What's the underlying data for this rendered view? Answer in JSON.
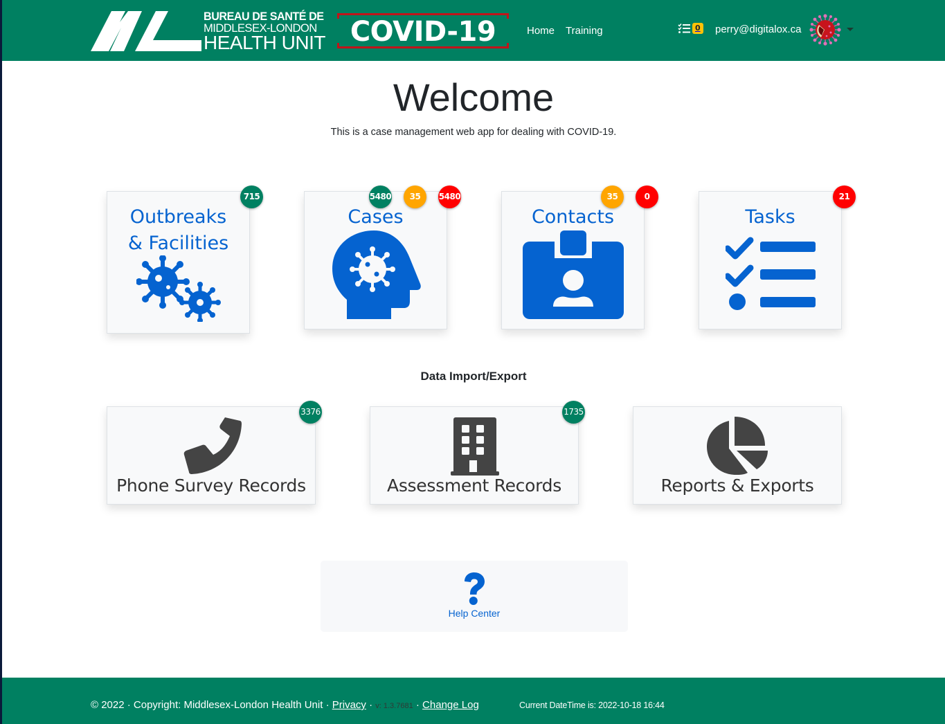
{
  "navbar": {
    "logo_mark": "ML",
    "logo_line1": "BUREAU DE SANTÉ DE",
    "logo_line2": "MIDDLESEX-LONDON",
    "logo_line3": "HEALTH UNIT",
    "app_badge": "COVID-19",
    "links": [
      {
        "label": "Home"
      },
      {
        "label": "Training"
      }
    ],
    "task_count": "0",
    "user_email": "perry@digitalox.ca",
    "avatar_icon": "coronavirus-avatar",
    "colors": {
      "brand": "#008061",
      "covid_border": "#c0141a",
      "task_badge": "#ffc107"
    }
  },
  "hero": {
    "title": "Welcome",
    "subtitle": "This is a case management web app for dealing with COVID-19."
  },
  "tiles": [
    {
      "title_line1": "Outbreaks",
      "title_line2": "& Facilities",
      "icon": "viruses-icon",
      "badges": [
        {
          "value": "715",
          "color": "green"
        }
      ]
    },
    {
      "title": "Cases",
      "icon": "head-virus-icon",
      "badges": [
        {
          "value": "5480",
          "color": "green"
        },
        {
          "value": "35",
          "color": "orange"
        },
        {
          "value": "5480",
          "color": "red"
        }
      ]
    },
    {
      "title": "Contacts",
      "icon": "id-badge-icon",
      "badges": [
        {
          "value": "35",
          "color": "orange"
        },
        {
          "value": "0",
          "color": "red"
        }
      ]
    },
    {
      "title": "Tasks",
      "icon": "tasks-list-icon",
      "badges": [
        {
          "value": "21",
          "color": "red"
        }
      ]
    }
  ],
  "data_section": {
    "label": "Data Import/Export",
    "tiles": [
      {
        "title": "Phone Survey Records",
        "icon": "phone-icon",
        "badge": "3376"
      },
      {
        "title": "Assessment Records",
        "icon": "building-icon",
        "badge": "1735"
      },
      {
        "title": "Reports & Exports",
        "icon": "pie-chart-icon"
      }
    ]
  },
  "help": {
    "label": "Help Center",
    "icon": "question-icon"
  },
  "footer": {
    "copyright": "© 2022 · Copyright: Middlesex-London Health Unit · ",
    "privacy": "Privacy",
    "sep1": " · ",
    "version": "v: 1.3.7681",
    "sep2": " · ",
    "changelog": "Change Log",
    "datetime": "Current DateTime is: 2022-10-18 16:44"
  },
  "colors": {
    "tile_title": "#0563d0",
    "badge_green": "#008061",
    "badge_orange": "#ffa500",
    "badge_red": "#ff0000",
    "data_icon": "#444444"
  }
}
